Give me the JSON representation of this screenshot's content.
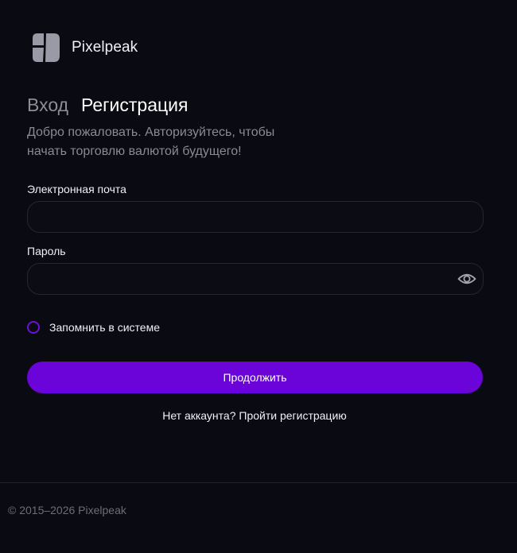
{
  "brand": {
    "name": "Pixelpeak",
    "logo_icon": "pixelpeak-logo-icon"
  },
  "tabs": {
    "login": "Вход",
    "register": "Регистрация",
    "active": "register"
  },
  "subtitle": "Добро пожаловать. Авторизуйтесь, чтобы начать торговлю валютой будущего!",
  "form": {
    "email": {
      "label": "Электронная почта",
      "value": "",
      "placeholder": ""
    },
    "password": {
      "label": "Пароль",
      "value": "",
      "placeholder": "",
      "toggle_icon": "eye-icon"
    },
    "remember": {
      "label": "Запомнить в системе",
      "checked": false
    },
    "continue_label": "Продолжить"
  },
  "signup": {
    "prefix": "Нет аккаунта?",
    "link": "Пройти регистрацию"
  },
  "footer": {
    "copyright": "© 2015–2026 Pixelpeak"
  },
  "colors": {
    "background": "#0a0a12",
    "accent": "#6a04d8",
    "muted_text": "#8a8a95",
    "border": "#26262f"
  }
}
